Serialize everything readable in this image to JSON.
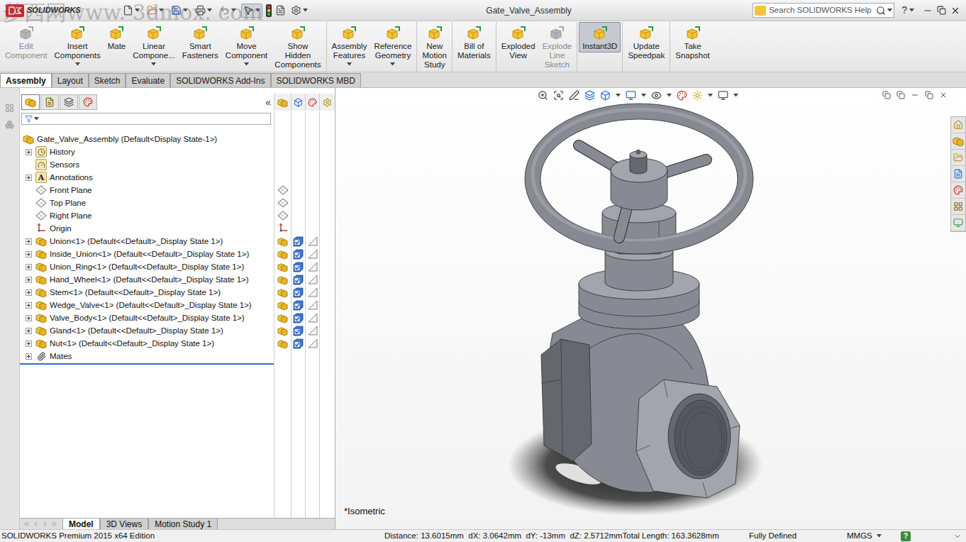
{
  "window": {
    "title": "Gate_Valve_Assembly",
    "app_logo": "SOLIDWORKS",
    "watermark": "梦西网www. 3dmox. com",
    "help_button": "?"
  },
  "search": {
    "placeholder": "Search SOLIDWORKS Help"
  },
  "toolbar": {
    "groups": [
      [
        {
          "lines": [
            "Edit",
            "Component"
          ],
          "disabled": true,
          "selected": false,
          "dropdown": false
        },
        {
          "lines": [
            "Insert",
            "Components"
          ],
          "disabled": false,
          "selected": false,
          "dropdown": true
        },
        {
          "lines": [
            "Mate"
          ],
          "disabled": false,
          "selected": false,
          "dropdown": false
        },
        {
          "lines": [
            "Linear",
            "Compone..."
          ],
          "disabled": false,
          "selected": false,
          "dropdown": true
        },
        {
          "lines": [
            "Smart",
            "Fasteners"
          ],
          "disabled": false,
          "selected": false,
          "dropdown": false
        },
        {
          "lines": [
            "Move",
            "Component"
          ],
          "disabled": false,
          "selected": false,
          "dropdown": true
        },
        {
          "lines": [
            "Show",
            "Hidden",
            "Components"
          ],
          "disabled": false,
          "selected": false,
          "dropdown": false
        }
      ],
      [
        {
          "lines": [
            "Assembly",
            "Features"
          ],
          "disabled": false,
          "selected": false,
          "dropdown": true
        },
        {
          "lines": [
            "Reference",
            "Geometry"
          ],
          "disabled": false,
          "selected": false,
          "dropdown": true
        }
      ],
      [
        {
          "lines": [
            "New",
            "Motion",
            "Study"
          ],
          "disabled": false,
          "selected": false,
          "dropdown": false
        }
      ],
      [
        {
          "lines": [
            "Bill of",
            "Materials"
          ],
          "disabled": false,
          "selected": false,
          "dropdown": false
        }
      ],
      [
        {
          "lines": [
            "Exploded",
            "View"
          ],
          "disabled": false,
          "selected": false,
          "dropdown": false
        },
        {
          "lines": [
            "Explode",
            "Line",
            "Sketch"
          ],
          "disabled": true,
          "selected": false,
          "dropdown": false
        }
      ],
      [
        {
          "lines": [
            "Instant3D"
          ],
          "disabled": false,
          "selected": true,
          "dropdown": false
        }
      ],
      [
        {
          "lines": [
            "Update",
            "Speedpak"
          ],
          "disabled": false,
          "selected": false,
          "dropdown": false
        }
      ],
      [
        {
          "lines": [
            "Take",
            "Snapshot"
          ],
          "disabled": false,
          "selected": false,
          "dropdown": false
        }
      ]
    ]
  },
  "tabs": [
    {
      "label": "Assembly",
      "selected": true
    },
    {
      "label": "Layout",
      "selected": false
    },
    {
      "label": "Sketch",
      "selected": false
    },
    {
      "label": "Evaluate",
      "selected": false
    },
    {
      "label": "SOLIDWORKS Add-Ins",
      "selected": false
    },
    {
      "label": "SOLIDWORKS MBD",
      "selected": false
    }
  ],
  "feature_tree": {
    "panel_tabs": [
      {
        "selected": true
      },
      {
        "selected": false
      },
      {
        "selected": false
      },
      {
        "selected": false
      }
    ],
    "collapse": "«",
    "items": [
      {
        "label": "Gate_Valve_Assembly  (Default<Display State-1>)",
        "kind": "root",
        "expandable": false,
        "expanded": true
      },
      {
        "label": "History",
        "kind": "history",
        "expandable": true,
        "expanded": false
      },
      {
        "label": "Sensors",
        "kind": "sensors",
        "expandable": false,
        "expanded": false
      },
      {
        "label": "Annotations",
        "kind": "annotations",
        "expandable": true,
        "expanded": false,
        "glyph": "A"
      },
      {
        "label": "Front Plane",
        "kind": "plane",
        "expandable": false,
        "expanded": false
      },
      {
        "label": "Top Plane",
        "kind": "plane",
        "expandable": false,
        "expanded": false
      },
      {
        "label": "Right Plane",
        "kind": "plane",
        "expandable": false,
        "expanded": false
      },
      {
        "label": "Origin",
        "kind": "origin",
        "expandable": false,
        "expanded": false
      },
      {
        "label": "Union<1> (Default<<Default>_Display State 1>)",
        "kind": "component",
        "expandable": true,
        "expanded": false
      },
      {
        "label": "Inside_Union<1> (Default<<Default>_Display State 1>)",
        "kind": "component",
        "expandable": true,
        "expanded": false
      },
      {
        "label": "Union_Ring<1> (Default<<Default>_Display State 1>)",
        "kind": "component",
        "expandable": true,
        "expanded": false
      },
      {
        "label": "Hand_Wheel<1> (Default<<Default>_Display State 1>)",
        "kind": "component",
        "expandable": true,
        "expanded": false
      },
      {
        "label": "Stem<1> (Default<<Default>_Display State 1>)",
        "kind": "component",
        "expandable": true,
        "expanded": false
      },
      {
        "label": "Wedge_Valve<1> (Default<<Default>_Display State 1>)",
        "kind": "component",
        "expandable": true,
        "expanded": false
      },
      {
        "label": "Valve_Body<1> (Default<<Default>_Display State 1>)",
        "kind": "component",
        "expandable": true,
        "expanded": false
      },
      {
        "label": "Gland<1> (Default<<Default>_Display State 1>)",
        "kind": "component",
        "expandable": true,
        "expanded": false
      },
      {
        "label": "Nut<1> (Default<<Default>_Display State 1>)",
        "kind": "component",
        "expandable": true,
        "expanded": false
      },
      {
        "label": "Mates",
        "kind": "mates",
        "expandable": true,
        "expanded": false
      }
    ]
  },
  "view_label": "*Isometric",
  "bottom_tabs": [
    {
      "label": "Model",
      "selected": true
    },
    {
      "label": "3D Views",
      "selected": false
    },
    {
      "label": "Motion Study 1",
      "selected": false
    }
  ],
  "status_bar": {
    "edition": "SOLIDWORKS Premium 2015 x64 Edition",
    "measure": "Distance: 13.6015mm  dX: 3.0642mm  dY: -13mm  dZ: 2.5712mmTotal Length: 163.3628mm",
    "state": "Fully Defined",
    "units": "MMGS",
    "help": "?"
  }
}
